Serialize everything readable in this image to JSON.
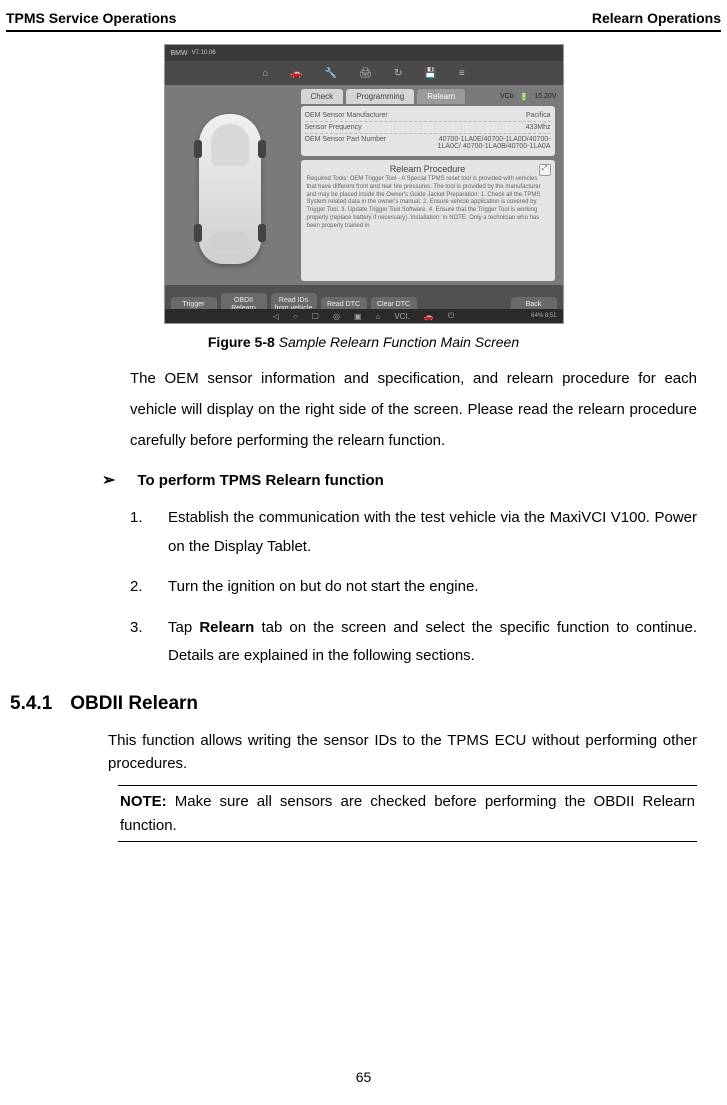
{
  "header": {
    "left": "TPMS Service Operations",
    "right": "Relearn Operations"
  },
  "screenshot": {
    "brand": "BMW",
    "version": "V7.10.06",
    "tabs": {
      "check": "Check",
      "programming": "Programming",
      "relearn": "Relearn"
    },
    "vci": {
      "label": "VCb",
      "voltage": "15.20V"
    },
    "info": {
      "manufacturer_label": "OEM Sensor Manufacturer",
      "manufacturer_value": "Pacifica",
      "frequency_label": "Sensor Frequency",
      "frequency_value": "433Mhz",
      "partnum_label": "OEM Sensor Part Number",
      "partnum_value": "40700-1LA0E/40700-1LA0D/40700-1LA0C/ 40700-1LA0B/40700-1LA0A"
    },
    "procedure": {
      "title": "Relearn Procedure",
      "body": "Required Tools:\nOEM Trigger Tool - A Special TPMS reset tool is provided with vehicles that have different front and rear tire pressures. The tool is provided by the manufacturer and may be placed inside the Owner's Guide Jacket Preparation:\n1. Check all the TPMS System related data in the owner's manual.\n2. Ensure vehicle application is covered by Trigger Tool.\n3. Update Trigger Tool Software.\n4. Ensure that the Trigger Tool is working properly (replace battery if necessary).\nInstallation: \\n NOTE: Only a technician who has been properly trained in"
    },
    "buttons": {
      "trigger": "Trigger",
      "obdii": "OBDII Relearn",
      "readids": "Read IDs from vehicle",
      "readdtc": "Read DTC",
      "cleardtc": "Clear DTC",
      "back": "Back"
    },
    "nav_time": "64%  8:51"
  },
  "caption": {
    "label": "Figure 5-8",
    "title": " Sample Relearn Function Main Screen"
  },
  "para1": "The OEM sensor information and specification, and relearn procedure for each vehicle will display on the right side of the screen. Please read the relearn procedure carefully before performing the relearn function.",
  "perform_heading": "To perform TPMS Relearn function",
  "steps": {
    "s1": "Establish the communication with the test vehicle via the MaxiVCI V100. Power on the Display Tablet.",
    "s2": "Turn the ignition on but do not start the engine.",
    "s3a": "Tap ",
    "s3b": "Relearn",
    "s3c": " tab on the screen and select the specific function to continue. Details are explained in the following sections."
  },
  "section": {
    "num": "5.4.1",
    "title": "OBDII Relearn"
  },
  "body": "This function allows writing the sensor IDs to the TPMS ECU without performing other procedures.",
  "note_label": "NOTE:",
  "note_body": " Make sure all sensors are checked before performing the OBDII Relearn function.",
  "page": "65"
}
